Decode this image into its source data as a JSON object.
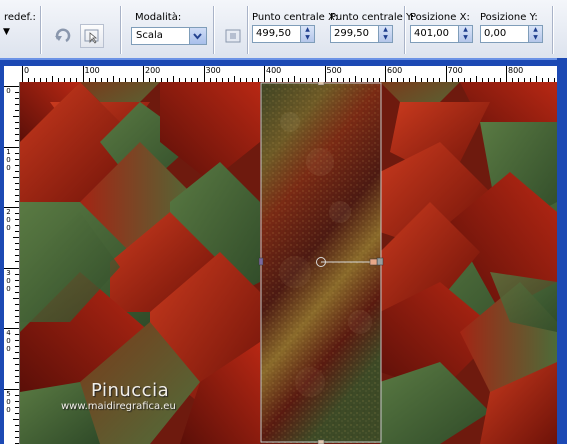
{
  "toolbar": {
    "preset_label": "redef.:",
    "mode": {
      "label": "Modalità:",
      "value": "Scala"
    },
    "center_x": {
      "label": "Punto centrale X:",
      "value": "499,50"
    },
    "center_y": {
      "label": "Punto centrale Y:",
      "value": "299,50"
    },
    "pos_x": {
      "label": "Posizione X:",
      "value": "401,00"
    },
    "pos_y": {
      "label": "Posizione Y:",
      "value": "0,00"
    }
  },
  "rulers": {
    "h_labels": [
      "0",
      "100",
      "200",
      "300",
      "400",
      "500",
      "600",
      "700",
      "800"
    ],
    "v_labels": [
      [
        "0"
      ],
      [
        "1",
        "0",
        "0"
      ],
      [
        "2",
        "0",
        "0"
      ],
      [
        "3",
        "0",
        "0"
      ],
      [
        "4",
        "0",
        "0"
      ],
      [
        "5",
        "0",
        "0"
      ]
    ]
  },
  "watermark": {
    "title": "Pinuccia",
    "url": "www.maidiregrafica.eu"
  },
  "colors": {
    "ui_blue": "#1c49b4",
    "pattern_red": "#a32514",
    "pattern_green": "#45653a",
    "panel_gold": "#8a6a2a"
  }
}
